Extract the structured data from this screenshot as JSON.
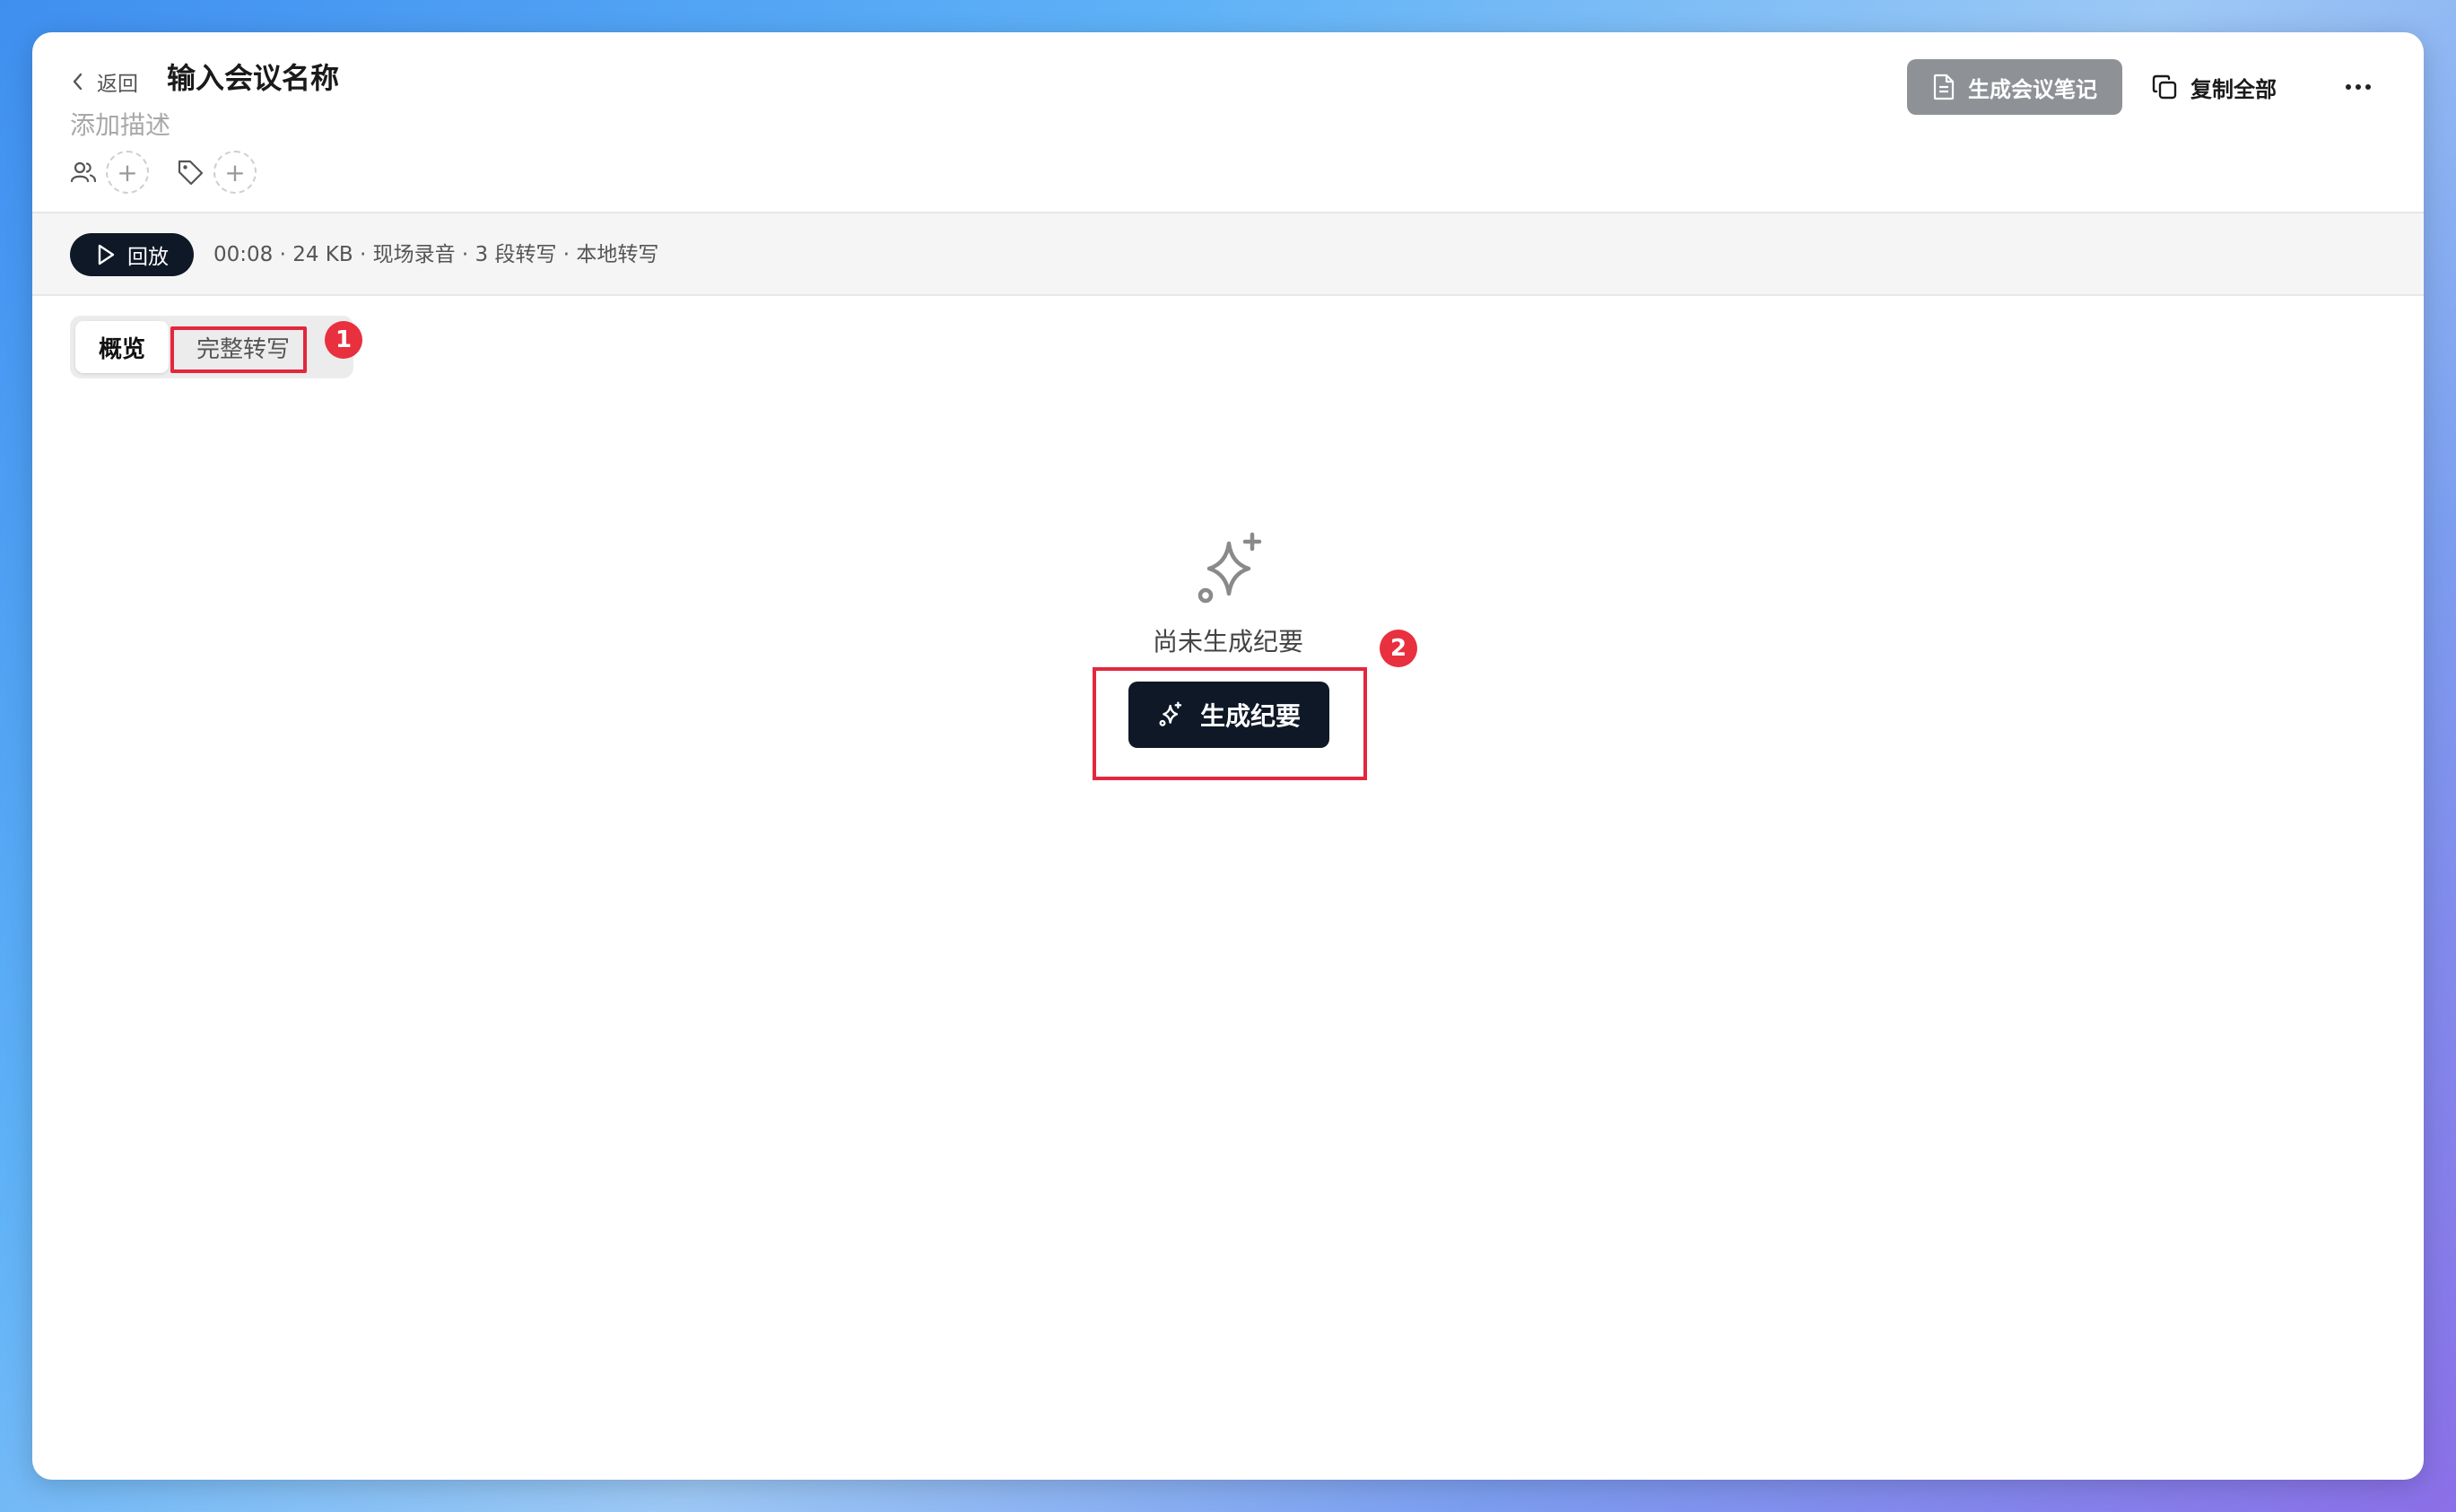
{
  "header": {
    "back_label": "返回",
    "title": "输入会议名称",
    "description_placeholder": "添加描述",
    "add_participant_symbol": "+",
    "add_tag_symbol": "+",
    "generate_notes_label": "生成会议笔记",
    "copy_all_label": "复制全部"
  },
  "infobar": {
    "play_label": "回放",
    "info_text": "00:08 · 24 KB · 现场录音 · 3 段转写 · 本地转写"
  },
  "tabs": [
    {
      "label": "概览",
      "active": true
    },
    {
      "label": "完整转写",
      "active": false
    }
  ],
  "empty_state": {
    "message": "尚未生成纪要",
    "generate_label": "生成纪要"
  },
  "annotations": [
    "1",
    "2"
  ],
  "colors": {
    "primary_dark": "#0f1827",
    "disabled_button": "#8e9297",
    "annotation_red": "#e3273d"
  },
  "icons": [
    "chevron-left-icon",
    "users-icon",
    "tag-icon",
    "document-icon",
    "copy-icon",
    "more-icon",
    "play-icon",
    "sparkles-icon"
  ]
}
